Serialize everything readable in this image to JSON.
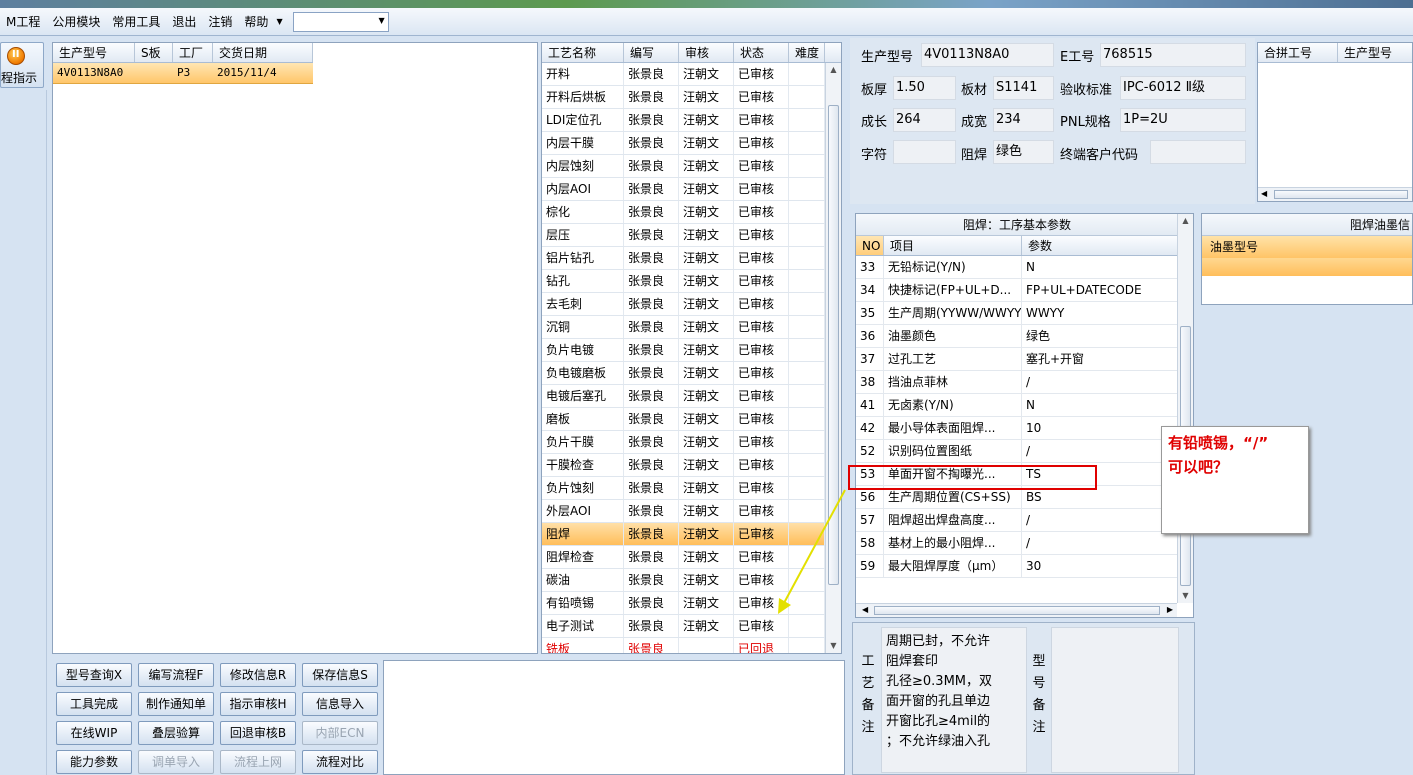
{
  "menubar": {
    "items": [
      "M工程",
      "公用模块",
      "常用工具",
      "退出",
      "注销",
      "帮助"
    ],
    "combo_value": ""
  },
  "sidebar": {
    "flow_button_label": "程指示"
  },
  "product_grid": {
    "columns": [
      "生产型号",
      "S板",
      "工厂",
      "交货日期"
    ],
    "rows": [
      [
        "4V0113N8A0",
        "",
        "P3",
        "2015/11/4"
      ]
    ]
  },
  "process_grid": {
    "columns": [
      "工艺名称",
      "编写",
      "审核",
      "状态",
      "难度"
    ],
    "rows": [
      [
        "开料",
        "张景良",
        "汪朝文",
        "已审核",
        ""
      ],
      [
        "开料后烘板",
        "张景良",
        "汪朝文",
        "已审核",
        ""
      ],
      [
        "LDI定位孔",
        "张景良",
        "汪朝文",
        "已审核",
        ""
      ],
      [
        "内层干膜",
        "张景良",
        "汪朝文",
        "已审核",
        ""
      ],
      [
        "内层蚀刻",
        "张景良",
        "汪朝文",
        "已审核",
        ""
      ],
      [
        "内层AOI",
        "张景良",
        "汪朝文",
        "已审核",
        ""
      ],
      [
        "棕化",
        "张景良",
        "汪朝文",
        "已审核",
        ""
      ],
      [
        "层压",
        "张景良",
        "汪朝文",
        "已审核",
        ""
      ],
      [
        "铝片钻孔",
        "张景良",
        "汪朝文",
        "已审核",
        ""
      ],
      [
        "钻孔",
        "张景良",
        "汪朝文",
        "已审核",
        ""
      ],
      [
        "去毛刺",
        "张景良",
        "汪朝文",
        "已审核",
        ""
      ],
      [
        "沉铜",
        "张景良",
        "汪朝文",
        "已审核",
        ""
      ],
      [
        "负片电镀",
        "张景良",
        "汪朝文",
        "已审核",
        ""
      ],
      [
        "负电镀磨板",
        "张景良",
        "汪朝文",
        "已审核",
        ""
      ],
      [
        "电镀后塞孔",
        "张景良",
        "汪朝文",
        "已审核",
        ""
      ],
      [
        "磨板",
        "张景良",
        "汪朝文",
        "已审核",
        ""
      ],
      [
        "负片干膜",
        "张景良",
        "汪朝文",
        "已审核",
        ""
      ],
      [
        "干膜检查",
        "张景良",
        "汪朝文",
        "已审核",
        ""
      ],
      [
        "负片蚀刻",
        "张景良",
        "汪朝文",
        "已审核",
        ""
      ],
      [
        "外层AOI",
        "张景良",
        "汪朝文",
        "已审核",
        ""
      ],
      [
        "阻焊",
        "张景良",
        "汪朝文",
        "已审核",
        ""
      ],
      [
        "阻焊检查",
        "张景良",
        "汪朝文",
        "已审核",
        ""
      ],
      [
        "碳油",
        "张景良",
        "汪朝文",
        "已审核",
        ""
      ],
      [
        "有铅喷锡",
        "张景良",
        "汪朝文",
        "已审核",
        ""
      ],
      [
        "电子测试",
        "张景良",
        "汪朝文",
        "已审核",
        ""
      ],
      [
        "铣板",
        "张景良",
        "",
        "已回退",
        ""
      ]
    ],
    "selected_index": 20,
    "red_index": 25
  },
  "buttons": [
    [
      "型号查询X",
      "编写流程F",
      "修改信息R",
      "保存信息S"
    ],
    [
      "工具完成",
      "制作通知单",
      "指示审核H",
      "信息导入"
    ],
    [
      "在线WIP",
      "叠层验算",
      "回退审核B",
      "内部ECN"
    ],
    [
      "能力参数",
      "调单导入",
      "流程上网",
      "流程对比"
    ]
  ],
  "disabled_buttons": [
    "内部ECN",
    "调单导入",
    "流程上网"
  ],
  "info": {
    "model_label": "生产型号",
    "model_value": "4V0113N8A0",
    "e_label": "E工号",
    "e_value": "768515",
    "thickness_label": "板厚",
    "thickness_value": "1.50",
    "material_label": "板材",
    "material_value": "S1141",
    "standard_label": "验收标准",
    "standard_value": "IPC-6012 Ⅱ级",
    "length_label": "成长",
    "length_value": "264",
    "width_label": "成宽",
    "width_value": "234",
    "pnl_label": "PNL规格",
    "pnl_value": "1P=2U",
    "char_label": "字符",
    "char_value": "",
    "mask_label": "阻焊",
    "mask_value": "绿色",
    "customer_label": "终端客户代码",
    "customer_value": ""
  },
  "combine_grid": {
    "columns": [
      "合拼工号",
      "生产型号"
    ]
  },
  "params": {
    "title": "阻焊：工序基本参数",
    "columns": [
      "NO",
      "项目",
      "参数"
    ],
    "rows": [
      [
        "33",
        "无铅标记(Y/N)",
        "N"
      ],
      [
        "34",
        "快捷标记(FP+UL+D...",
        "FP+UL+DATECODE"
      ],
      [
        "35",
        "生产周期(YYWW/WWYY)",
        "WWYY"
      ],
      [
        "36",
        "油墨颜色",
        "绿色"
      ],
      [
        "37",
        "过孔工艺",
        "塞孔+开窗"
      ],
      [
        "38",
        "挡油点菲林",
        "/"
      ],
      [
        "41",
        "无卤素(Y/N)",
        "N"
      ],
      [
        "42",
        "最小导体表面阻焊...",
        "10"
      ],
      [
        "52",
        "识别码位置图纸",
        "/"
      ],
      [
        "53",
        "单面开窗不掏曝光...",
        "TS"
      ],
      [
        "56",
        "生产周期位置(CS+SS)",
        "BS"
      ],
      [
        "57",
        "阻焊超出焊盘高度...",
        "/"
      ],
      [
        "58",
        "基材上的最小阻焊...",
        "/"
      ],
      [
        "59",
        "最大阻焊厚度（μm）",
        "30"
      ]
    ]
  },
  "ink": {
    "title": "阻焊油墨信",
    "column": "油墨型号"
  },
  "notes": {
    "process_label": [
      "工",
      "艺",
      "备",
      "注"
    ],
    "process_text": [
      "周期已封，不允许",
      "阻焊套印",
      "孔径≥0.3MM，双",
      "面开窗的孔且单边",
      "开窗比孔≥4mil的",
      "；不允许绿油入孔"
    ],
    "model_label": [
      "型",
      "号",
      "备",
      "注"
    ]
  },
  "annotation": {
    "line1": "有铅喷锡，“/”",
    "line2": "可以吧？"
  }
}
